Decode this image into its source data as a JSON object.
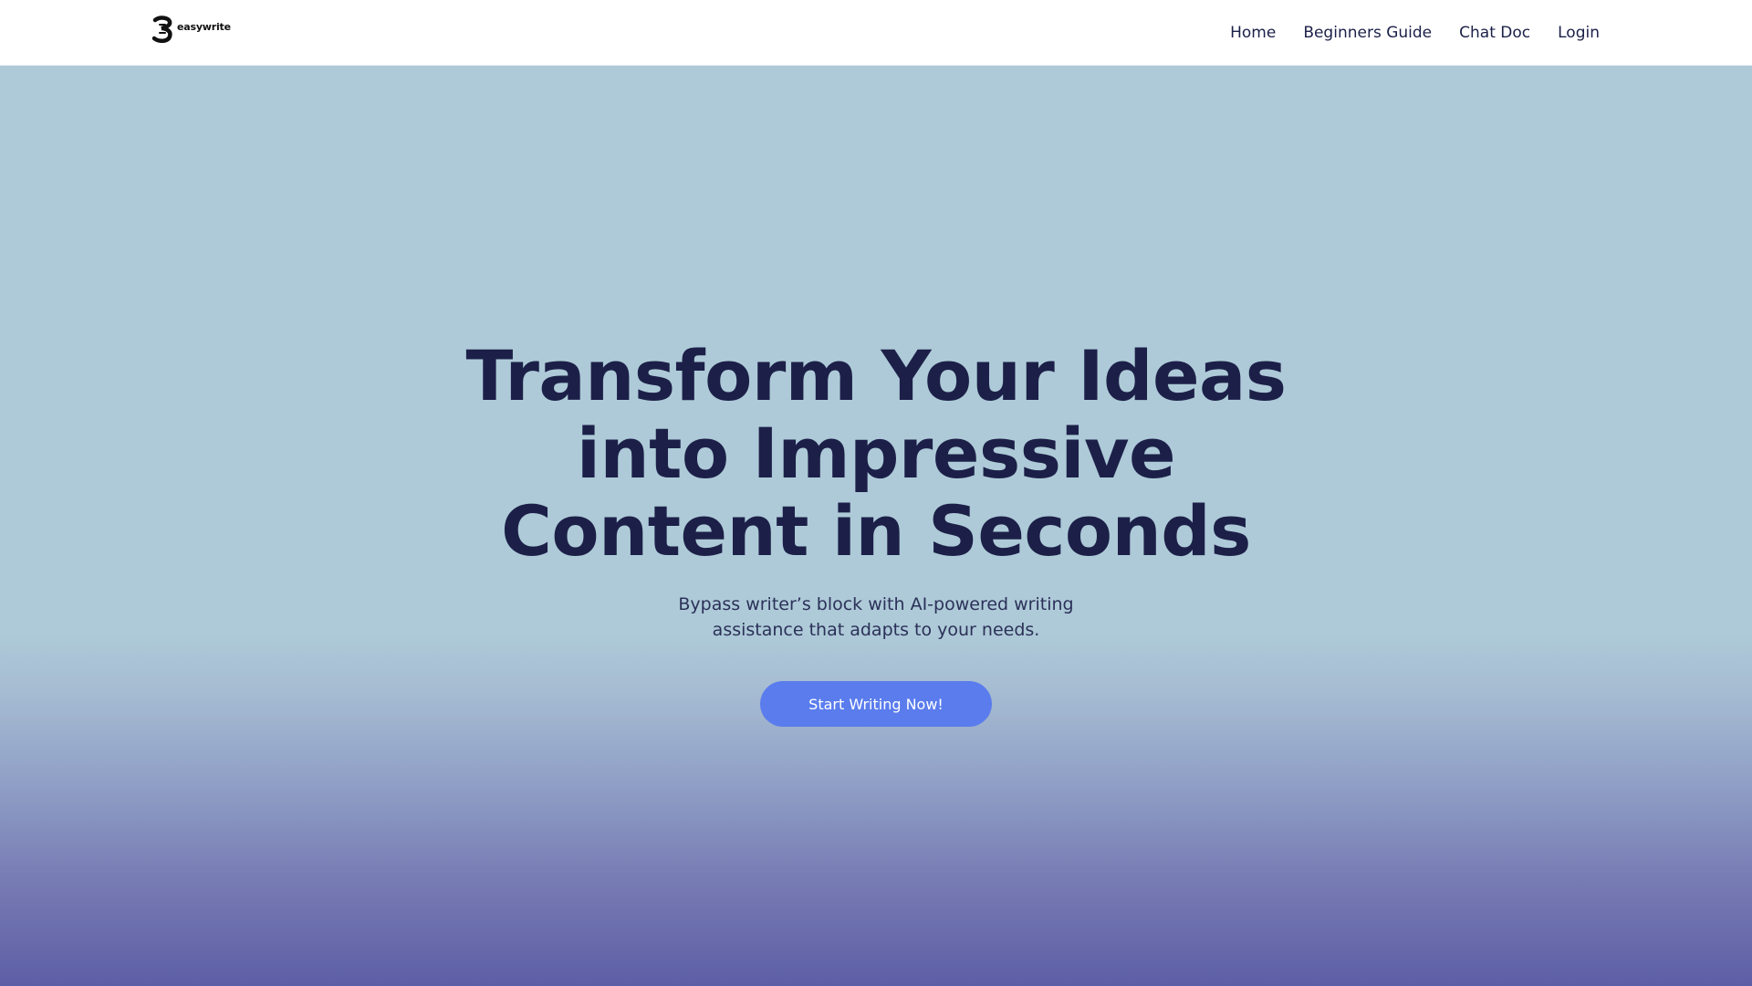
{
  "header": {
    "logo_text": "easywrite",
    "nav": [
      {
        "label": "Home"
      },
      {
        "label": "Beginners Guide"
      },
      {
        "label": "Chat Doc"
      },
      {
        "label": "Login"
      }
    ]
  },
  "hero": {
    "title_lines": [
      "Transform Your Ideas",
      "into Impressive",
      "Content in Seconds"
    ],
    "subtitle_lines": [
      "Bypass writer’s block with AI-powered writing",
      "assistance that adapts to your needs."
    ],
    "cta_label": "Start Writing Now!"
  },
  "colors": {
    "header_bg": "#ffffff",
    "hero_bg": "#aecad8",
    "hero_gradient_end": "#5d5ea6",
    "title": "#1c2048",
    "button": "#5a7ced",
    "button_text": "#ffffff"
  },
  "icons": {
    "logo": "easywrite-logo-icon"
  }
}
